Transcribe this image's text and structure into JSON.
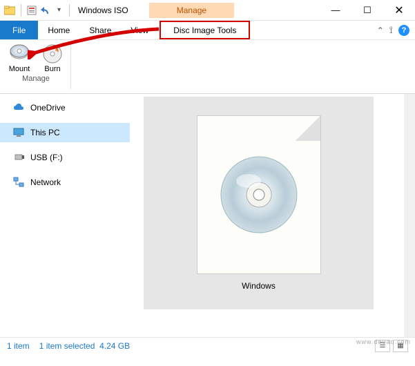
{
  "titlebar": {
    "title": "Windows ISO",
    "context_tab": "Manage"
  },
  "menubar": {
    "file": "File",
    "home": "Home",
    "share": "Share",
    "view": "View",
    "disc_tools": "Disc Image Tools"
  },
  "ribbon": {
    "mount": "Mount",
    "burn": "Burn",
    "group": "Manage"
  },
  "sidebar": {
    "items": [
      {
        "label": "OneDrive",
        "icon": "cloud"
      },
      {
        "label": "This PC",
        "icon": "monitor",
        "selected": true
      },
      {
        "label": "USB (F:)",
        "icon": "usb"
      },
      {
        "label": "Network",
        "icon": "network"
      }
    ]
  },
  "content": {
    "file_name": "Windows"
  },
  "statusbar": {
    "count": "1 item",
    "selection": "1 item selected",
    "size": "4.24 GB"
  },
  "watermark": "www.deuaq.com"
}
